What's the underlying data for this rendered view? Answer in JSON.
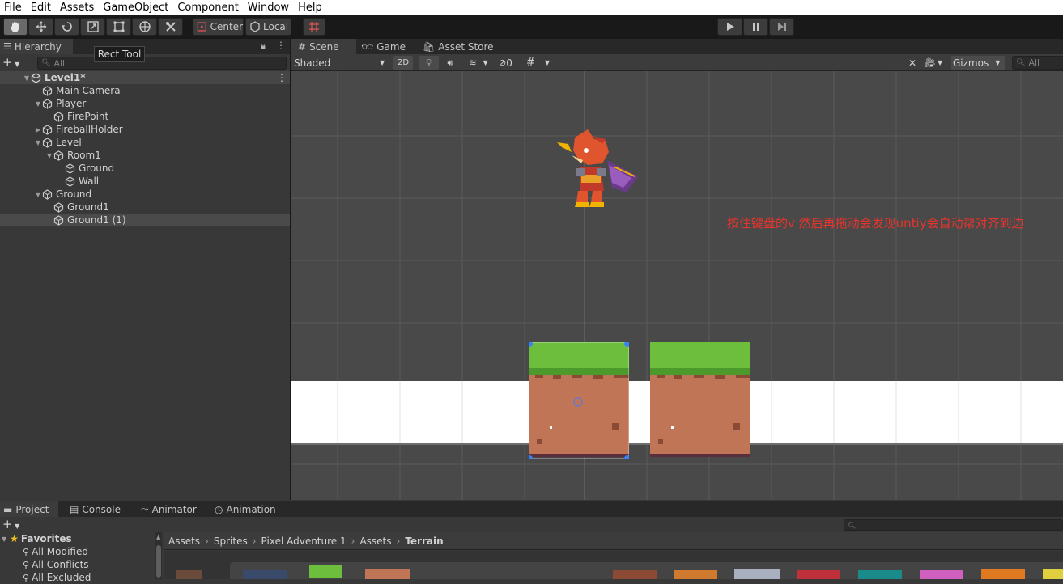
{
  "menu": [
    "File",
    "Edit",
    "Assets",
    "GameObject",
    "Component",
    "Window",
    "Help"
  ],
  "toolbar": {
    "pivot_label": "Center",
    "space_label": "Local",
    "tooltip": "Rect Tool"
  },
  "hierarchy": {
    "tab_label": "Hierarchy",
    "search_placeholder": "All",
    "scene_name": "Level1*",
    "items": [
      {
        "label": "Main Camera",
        "depth": 1,
        "arrow": ""
      },
      {
        "label": "Player",
        "depth": 1,
        "arrow": "down"
      },
      {
        "label": "FirePoint",
        "depth": 2,
        "arrow": ""
      },
      {
        "label": "FireballHolder",
        "depth": 1,
        "arrow": "right"
      },
      {
        "label": "Level",
        "depth": 1,
        "arrow": "down"
      },
      {
        "label": "Room1",
        "depth": 2,
        "arrow": "down"
      },
      {
        "label": "Ground",
        "depth": 3,
        "arrow": ""
      },
      {
        "label": "Wall",
        "depth": 3,
        "arrow": ""
      },
      {
        "label": "Ground",
        "depth": 1,
        "arrow": "down"
      },
      {
        "label": "Ground1",
        "depth": 2,
        "arrow": ""
      },
      {
        "label": "Ground1 (1)",
        "depth": 2,
        "arrow": "",
        "selected": true
      }
    ]
  },
  "scene_view": {
    "tabs": [
      "Scene",
      "Game",
      "Asset Store"
    ],
    "shading_mode": "Shaded",
    "mode_2d": "2D",
    "hidden_count": "0",
    "gizmos_label": "Gizmos",
    "search_placeholder": "All",
    "annotation": "按住键盘的v 然后再拖动会发现untiy会自动帮对齐到边",
    "annotation_color": "#e8342c"
  },
  "bottom": {
    "tabs": [
      "Project",
      "Console",
      "Animator",
      "Animation"
    ],
    "favorites_label": "Favorites",
    "favorites": [
      "All Modified",
      "All Conflicts",
      "All Excluded"
    ],
    "breadcrumb": [
      "Assets",
      "Sprites",
      "Pixel Adventure 1",
      "Assets",
      "Terrain"
    ]
  },
  "colors": {
    "accent_selection": "#4a4a4a",
    "scene_bg": "#494949",
    "grass": "#6cbe3c",
    "dirt": "#c07656"
  }
}
